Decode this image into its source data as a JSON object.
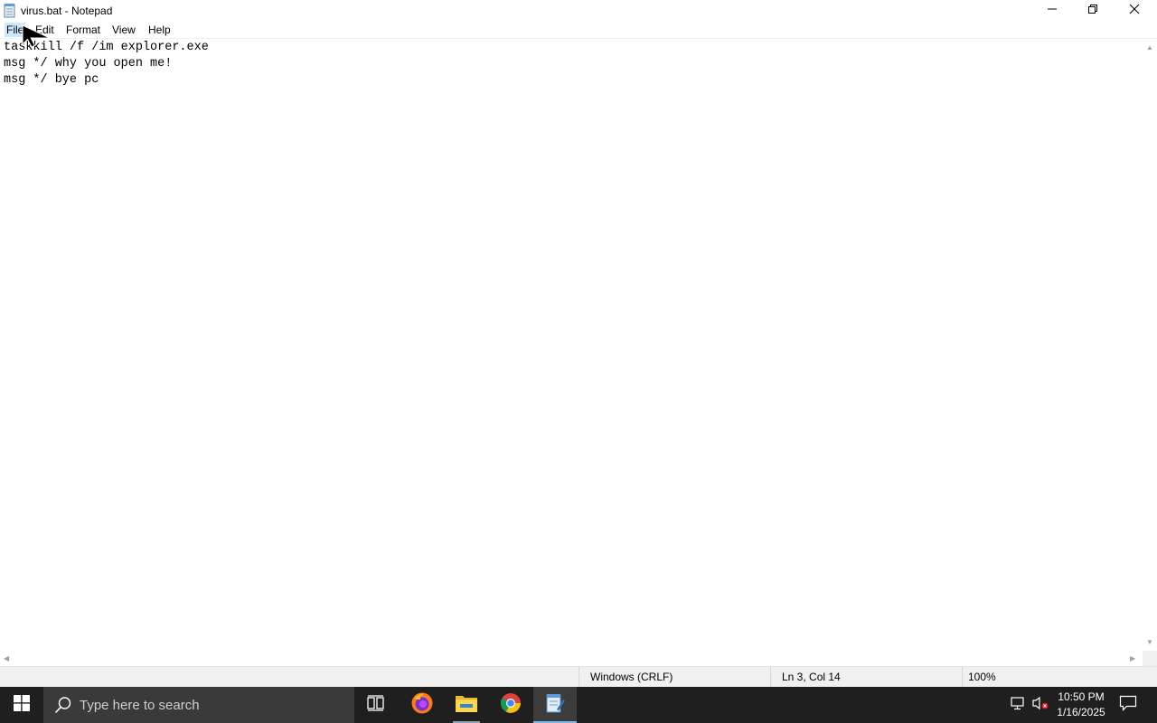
{
  "window": {
    "title": "virus.bat - Notepad",
    "controls": [
      "minimize-icon",
      "restore-icon",
      "close-icon"
    ]
  },
  "menu": {
    "file": "File",
    "edit": "Edit",
    "format": "Format",
    "view": "View",
    "help": "Help"
  },
  "editor": {
    "content": "taskkill /f /im explorer.exe\nmsg */ why you open me!\nmsg */ bye pc"
  },
  "status": {
    "line_ending": "Windows (CRLF)",
    "position": "Ln 3, Col 14",
    "zoom": "100%"
  },
  "taskbar": {
    "search_placeholder": "Type here to search",
    "apps": [
      "windows-start-icon",
      "task-view-icon",
      "firefox-icon",
      "file-explorer-icon",
      "chrome-icon",
      "notepad-icon"
    ],
    "clock_time": "10:50 PM",
    "clock_date": "1/16/2025",
    "accent_color": "#76b9ed"
  }
}
